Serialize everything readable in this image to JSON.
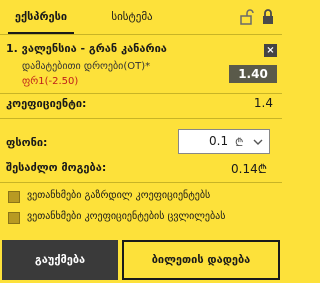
{
  "tabs": [
    {
      "label": "ექსპრესი"
    },
    {
      "label": "სისტემა"
    }
  ],
  "bet": {
    "event_title": "1. ვალენსია - გრან კანარია",
    "market": "დამატებითი დროები(OT)*",
    "outcome": "ფრ1(-2.50)",
    "odd": "1.40",
    "remove": "×"
  },
  "summary": {
    "coef_label": "კოეფიციენტი:",
    "coef_value": "1.4",
    "stake_label": "ფსონი:",
    "stake_value": "0.1",
    "stake_currency": "₾",
    "win_label": "შესაძლო მოგება:",
    "win_value": "0.14₾"
  },
  "options": [
    {
      "label": "ვეთანხმები გაზრდილ კოეფიციენტებს"
    },
    {
      "label": "ვეთანხმები კოეფიციენტების ცვლილებას"
    }
  ],
  "buttons": {
    "cancel": "გაუქმება",
    "place": "ბილეთის დადება"
  },
  "colors": {
    "background": "#fde13a",
    "outcome": "#c0201a",
    "odd_box": "#5a5a4a"
  }
}
